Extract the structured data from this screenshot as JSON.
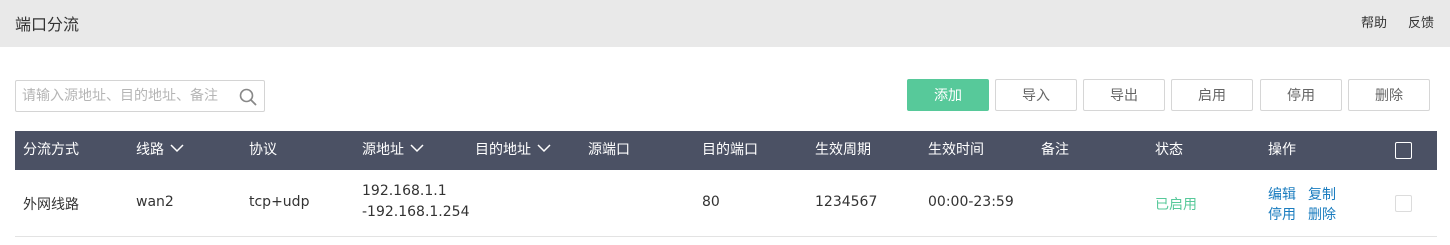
{
  "header": {
    "title": "端口分流",
    "help": "帮助",
    "feedback": "反馈"
  },
  "search": {
    "placeholder": "请输入源地址、目的地址、备注"
  },
  "toolbar": {
    "add": "添加",
    "import": "导入",
    "export": "导出",
    "enable": "启用",
    "disable": "停用",
    "delete": "删除"
  },
  "table": {
    "columns": {
      "mode": "分流方式",
      "line": "线路",
      "protocol": "协议",
      "src_addr": "源地址",
      "dst_addr": "目的地址",
      "src_port": "源端口",
      "dst_port": "目的端口",
      "period": "生效周期",
      "time": "生效时间",
      "remark": "备注",
      "status": "状态",
      "ops": "操作"
    },
    "rows": [
      {
        "mode": "外网线路",
        "line": "wan2",
        "protocol": "tcp+udp",
        "src_addr_line1": "192.168.1.1",
        "src_addr_line2": "-192.168.1.254",
        "dst_addr": "",
        "src_port": "",
        "dst_port": "80",
        "period": "1234567",
        "time": "00:00-23:59",
        "remark": "",
        "status": "已启用",
        "ops": {
          "edit": "编辑",
          "copy": "复制",
          "disable": "停用",
          "delete": "删除"
        }
      }
    ]
  },
  "colors": {
    "accent_green": "#57c99a",
    "header_bg": "#4b5164",
    "topbar_bg": "#e9e9e9",
    "link_blue": "#1a7cbf"
  },
  "icons": {
    "search": "search-icon",
    "sort": "chevron-down-icon"
  }
}
